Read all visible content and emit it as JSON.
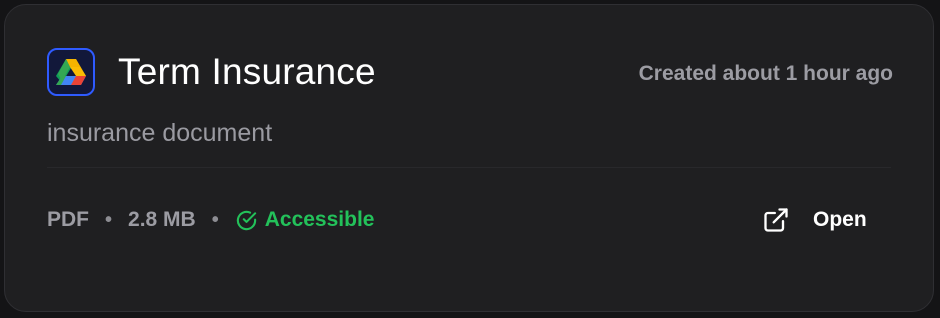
{
  "card": {
    "icon": "google-drive-icon",
    "title": "Term Insurance",
    "created": "Created about 1 hour ago",
    "description": "insurance document",
    "file_type": "PDF",
    "separator": "•",
    "file_size": "2.8 MB",
    "status": "Accessible",
    "status_icon": "check-circle-icon",
    "open_label": "Open",
    "open_icon": "external-link-icon"
  },
  "colors": {
    "background": "#1f1f21",
    "status": "#23c15a",
    "icon_border": "#2f5bff"
  }
}
